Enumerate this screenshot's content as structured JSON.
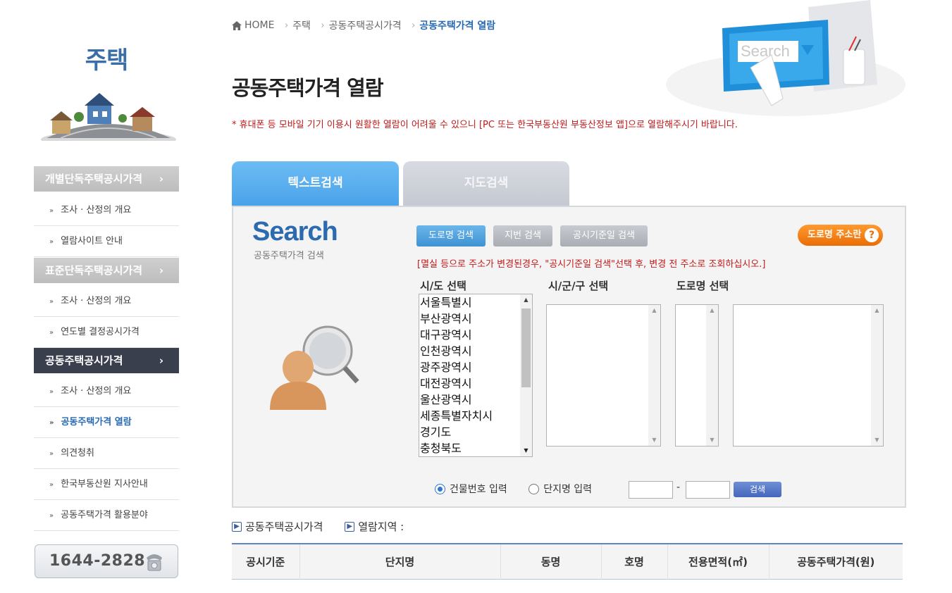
{
  "sidebar": {
    "title": "주택",
    "sections": [
      {
        "label": "개별단독주택공시가격",
        "arrow": "›"
      },
      {
        "label": "표준단독주택공시가격",
        "arrow": "›"
      },
      {
        "label": "공동주택공시가격",
        "arrow": "›"
      }
    ],
    "items": [
      "조사 · 산정의 개요",
      "열람사이트 안내",
      "조사 · 산정의 개요",
      "연도별 결정공시가격",
      "조사 · 산정의 개요",
      "공동주택가격 열람",
      "의견청취",
      "한국부동산원 지사안내",
      "공동주택가격 활용분야"
    ],
    "bullet": "»",
    "phone": "1644-2828"
  },
  "breadcrumb": {
    "home": "HOME",
    "items": [
      "주택",
      "공동주택공시가격",
      "공동주택가격 열람"
    ],
    "sep": "›"
  },
  "page": {
    "title": "공동주택가격 열람",
    "notice": "* 휴대폰 등 모바일 기기 이용시 원활한 열람이 어려울 수 있으니 [PC 또는 한국부동산원 부동산정보 앱]으로 열람해주시기 바랍니다.",
    "header_image_text": "Search"
  },
  "tabs": [
    {
      "label": "텍스트검색",
      "active": true
    },
    {
      "label": "지도검색",
      "active": false
    }
  ],
  "search": {
    "logo": "Search",
    "logo_sub": "공동주택가격 검색",
    "buttons": {
      "road": "도로명 검색",
      "jibun": "지번 검색",
      "std": "공시기준일 검색"
    },
    "guide": "도로명 주소란",
    "guide_icon": "?",
    "notice": "[멸실 등으로 주소가 변경된경우, \"공시기준일 검색\"선택 후, 변경 전 주소로 조회하십시오.]",
    "labels": {
      "sido": "시/도 선택",
      "sigungu": "시/군/구 선택",
      "road": "도로명 선택"
    },
    "sido_options": [
      "서울특별시",
      "부산광역시",
      "대구광역시",
      "인천광역시",
      "광주광역시",
      "대전광역시",
      "울산광역시",
      "세종특별자치시",
      "경기도",
      "충청북도"
    ],
    "radios": {
      "building": "건물번호 입력",
      "complex": "단지명 입력"
    },
    "dash": "-",
    "search_button": "검색"
  },
  "info": {
    "price": "공동주택공시가격",
    "region": "열람지역 :"
  },
  "table": {
    "headers": [
      "공시기준",
      "단지명",
      "동명",
      "호명",
      "전용면적(㎡)",
      "공동주택가격(원)"
    ]
  },
  "colors": {
    "accent_blue": "#2a6bb5",
    "notice_red": "#c21a1a",
    "active_tab": "#4aa3e9",
    "sidebar_active": "#3a3f4e",
    "guide_orange": "#ea6d07"
  }
}
